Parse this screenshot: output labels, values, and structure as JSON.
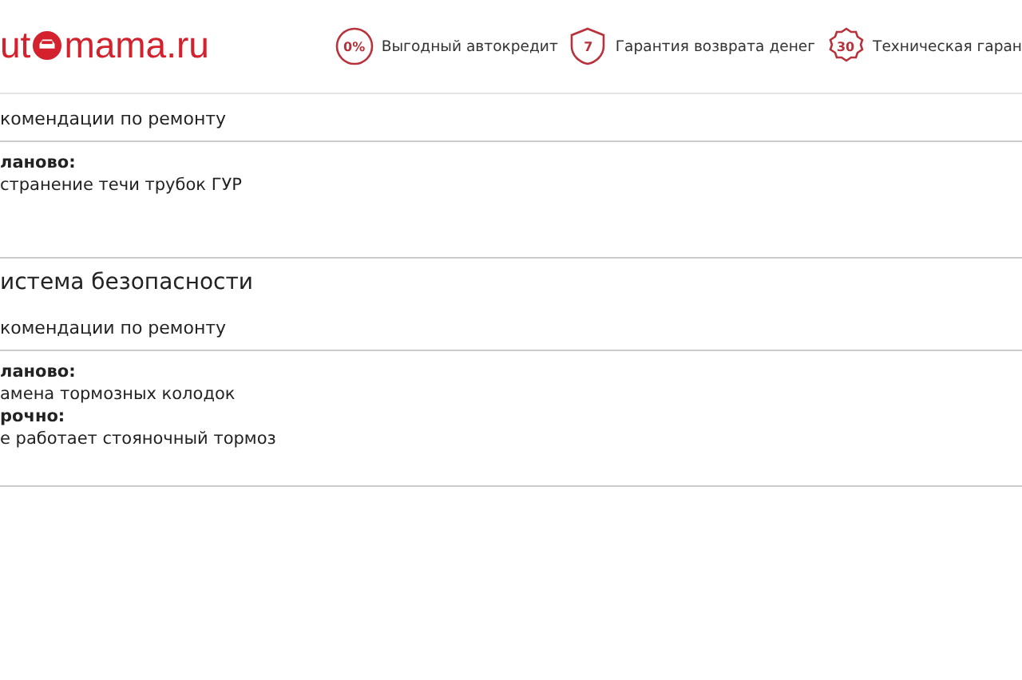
{
  "header": {
    "logo": {
      "before": "ut",
      "after": "mama.ru"
    },
    "features": [
      {
        "kind": "circle",
        "badge": "0%",
        "label": "Выгодный автокредит"
      },
      {
        "kind": "shield",
        "badge": "7",
        "label": "Гарантия возврата денег"
      },
      {
        "kind": "seal",
        "badge": "30",
        "label": "Техническая гаран"
      }
    ]
  },
  "sections": [
    {
      "subtitle": "комендации по ремонту",
      "groups": [
        {
          "label": "ланово:",
          "items": [
            "странение течи трубок ГУР"
          ]
        }
      ]
    },
    {
      "title": "истема безопасности",
      "subtitle": "комендации по ремонту",
      "groups": [
        {
          "label": "ланово:",
          "items": [
            "амена тормозных колодок"
          ]
        },
        {
          "label": "рочно:",
          "items": [
            "е работает стояночный тормоз"
          ]
        }
      ]
    }
  ]
}
